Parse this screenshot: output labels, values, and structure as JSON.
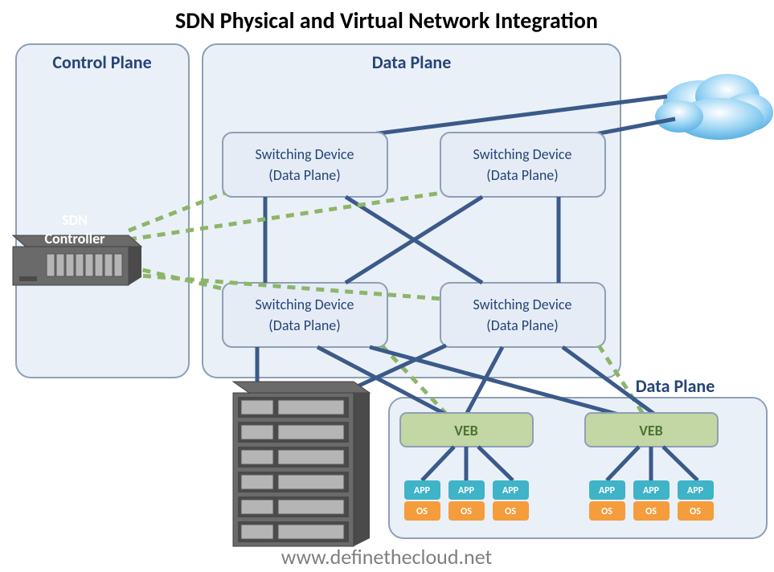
{
  "title": "SDN Physical and Virtual Network Integration",
  "control_plane": {
    "label": "Control Plane",
    "controller": {
      "line1": "SDN",
      "line2": "Controller"
    }
  },
  "data_plane": {
    "label": "Data Plane",
    "switches": [
      {
        "line1": "Switching Device",
        "line2": "(Data Plane)"
      },
      {
        "line1": "Switching Device",
        "line2": "(Data Plane)"
      },
      {
        "line1": "Switching Device",
        "line2": "(Data Plane)"
      },
      {
        "line1": "Switching Device",
        "line2": "(Data Plane)"
      }
    ]
  },
  "data_plane2": {
    "label": "Data Plane",
    "vebs": [
      {
        "label": "VEB"
      },
      {
        "label": "VEB"
      }
    ],
    "vms": [
      {
        "app": "APP",
        "os": "OS"
      },
      {
        "app": "APP",
        "os": "OS"
      },
      {
        "app": "APP",
        "os": "OS"
      },
      {
        "app": "APP",
        "os": "OS"
      },
      {
        "app": "APP",
        "os": "OS"
      },
      {
        "app": "APP",
        "os": "OS"
      }
    ]
  },
  "url": "www.definethecloud.net"
}
